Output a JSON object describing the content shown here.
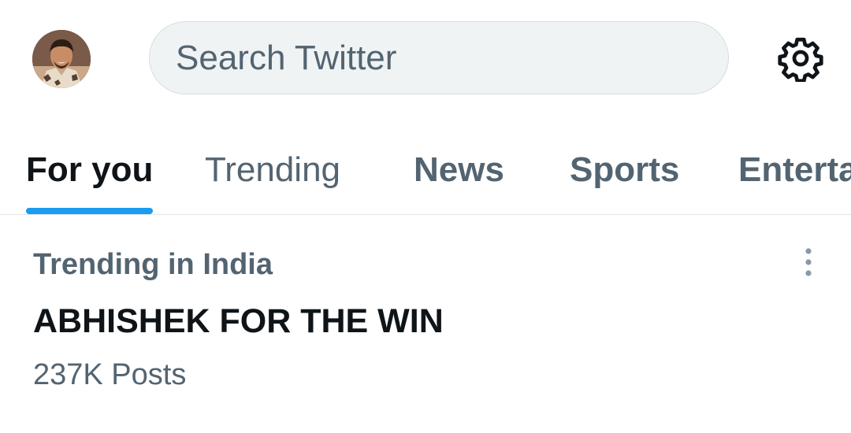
{
  "header": {
    "avatar_alt": "Profile",
    "search_placeholder": "Search Twitter",
    "settings_icon": "gear-icon"
  },
  "tabs": [
    {
      "label": "For you",
      "active": true
    },
    {
      "label": "Trending",
      "active": false
    },
    {
      "label": "News",
      "active": false
    },
    {
      "label": "Sports",
      "active": false
    },
    {
      "label": "Entertainment",
      "active": false
    }
  ],
  "trend": {
    "context": "Trending in India",
    "title": "ABHISHEK FOR THE WIN",
    "count": "237K Posts",
    "more_icon": "more-vertical-icon"
  },
  "colors": {
    "accent": "#1d9bf0",
    "text_primary": "#0f1419",
    "text_secondary": "#536471",
    "search_bg": "#eff3f4"
  }
}
